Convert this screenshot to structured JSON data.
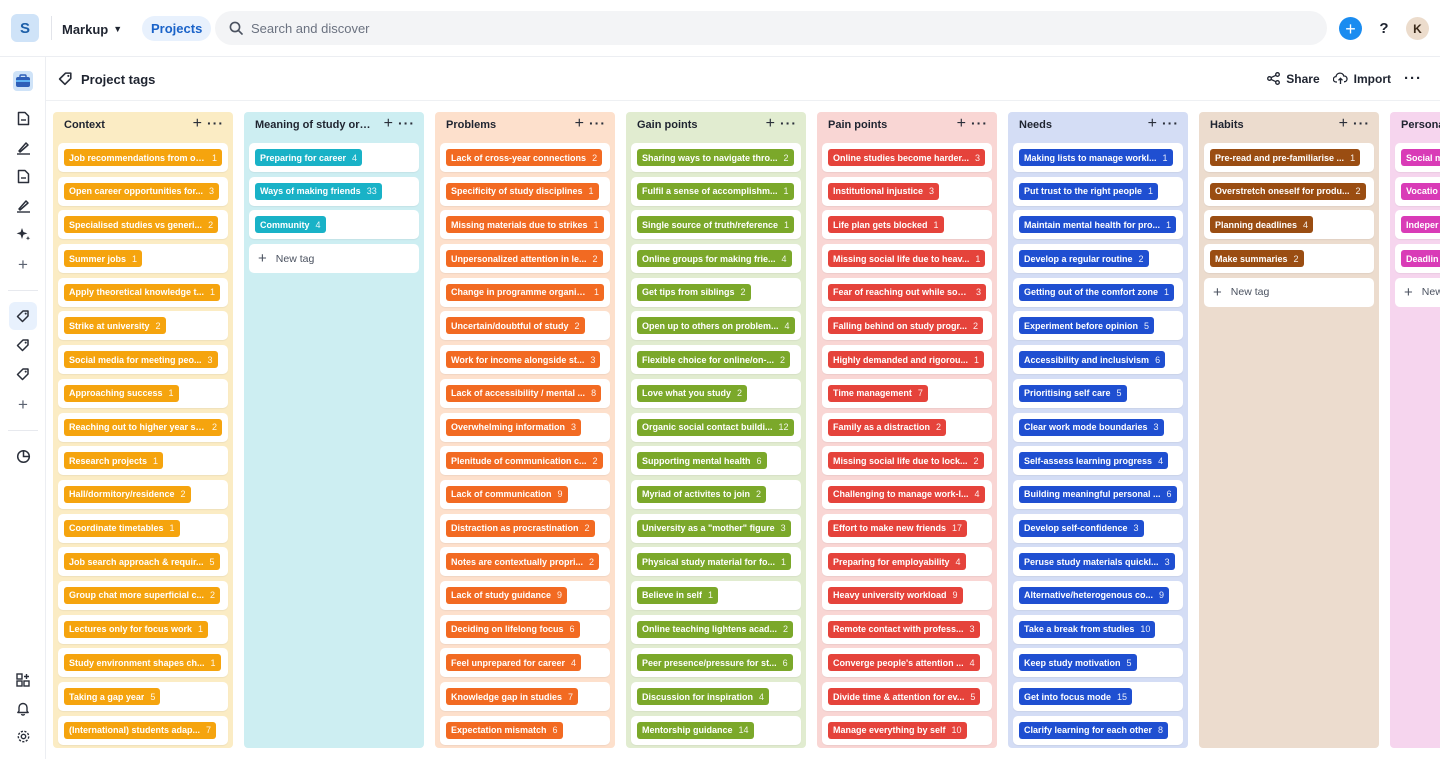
{
  "topbar": {
    "logo_letter": "S",
    "workspace": "Markup",
    "projects_label": "Projects",
    "search_placeholder": "Search and discover",
    "avatar_letter": "K",
    "help_label": "?"
  },
  "page": {
    "title": "Project tags",
    "share_label": "Share",
    "import_label": "Import"
  },
  "new_tag_label": "New tag",
  "columns": [
    {
      "title": "Context",
      "bg": "#fbecc4",
      "tag_color": "#f5a40e",
      "tags": [
        {
          "label": "Job recommendations from ot...",
          "count": "1"
        },
        {
          "label": "Open career opportunities for...",
          "count": "3"
        },
        {
          "label": "Specialised studies vs generi...",
          "count": "2"
        },
        {
          "label": "Summer jobs",
          "count": "1"
        },
        {
          "label": "Apply theoretical knowledge t...",
          "count": "1"
        },
        {
          "label": "Strike at university",
          "count": "2"
        },
        {
          "label": "Social media for meeting peo...",
          "count": "3"
        },
        {
          "label": "Approaching success",
          "count": "1"
        },
        {
          "label": "Reaching out to higher year st...",
          "count": "2"
        },
        {
          "label": "Research projects",
          "count": "1"
        },
        {
          "label": "Hall/dormitory/residence",
          "count": "2"
        },
        {
          "label": "Coordinate timetables",
          "count": "1"
        },
        {
          "label": "Job search approach & requir...",
          "count": "5"
        },
        {
          "label": "Group chat more superficial c...",
          "count": "2"
        },
        {
          "label": "Lectures only for focus work",
          "count": "1"
        },
        {
          "label": "Study environment shapes ch...",
          "count": "1"
        },
        {
          "label": "Taking a gap year",
          "count": "5"
        },
        {
          "label": "(International) students adap...",
          "count": "7"
        }
      ],
      "show_new_tag": false
    },
    {
      "title": "Meaning of study or ...",
      "bg": "#cdeef2",
      "tag_color": "#19b2c7",
      "tags": [
        {
          "label": "Preparing for career",
          "count": "4"
        },
        {
          "label": "Ways of making friends",
          "count": "33"
        },
        {
          "label": "Community",
          "count": "4"
        }
      ],
      "show_new_tag": true
    },
    {
      "title": "Problems",
      "bg": "#fde0cc",
      "tag_color": "#f26a22",
      "tags": [
        {
          "label": "Lack of cross-year connections",
          "count": "2"
        },
        {
          "label": "Specificity of study disciplines",
          "count": "1"
        },
        {
          "label": "Missing materials due to strikes",
          "count": "1"
        },
        {
          "label": "Unpersonalized attention in le...",
          "count": "2"
        },
        {
          "label": "Change in programme organis...",
          "count": "1"
        },
        {
          "label": "Uncertain/doubtful of study",
          "count": "2"
        },
        {
          "label": "Work for income alongside st...",
          "count": "3"
        },
        {
          "label": "Lack of accessibility / mental ...",
          "count": "8"
        },
        {
          "label": "Overwhelming information",
          "count": "3"
        },
        {
          "label": "Plenitude of communication c...",
          "count": "2"
        },
        {
          "label": "Lack of communication",
          "count": "9"
        },
        {
          "label": "Distraction as procrastination",
          "count": "2"
        },
        {
          "label": "Notes are contextually propri...",
          "count": "2"
        },
        {
          "label": "Lack of study guidance",
          "count": "9"
        },
        {
          "label": "Deciding on lifelong focus",
          "count": "6"
        },
        {
          "label": "Feel unprepared for career",
          "count": "4"
        },
        {
          "label": "Knowledge gap in studies",
          "count": "7"
        },
        {
          "label": "Expectation mismatch",
          "count": "6"
        }
      ],
      "show_new_tag": false
    },
    {
      "title": "Gain points",
      "bg": "#e1ecd0",
      "tag_color": "#7ba82a",
      "tags": [
        {
          "label": "Sharing ways to navigate thro...",
          "count": "2"
        },
        {
          "label": "Fulfil a sense of accomplishm...",
          "count": "1"
        },
        {
          "label": "Single source of truth/reference",
          "count": "1"
        },
        {
          "label": "Online groups for making frie...",
          "count": "4"
        },
        {
          "label": "Get tips from siblings",
          "count": "2"
        },
        {
          "label": "Open up to others on problem...",
          "count": "4"
        },
        {
          "label": "Flexible choice for online/on-...",
          "count": "2"
        },
        {
          "label": "Love what you study",
          "count": "2"
        },
        {
          "label": "Organic social contact buildi...",
          "count": "12"
        },
        {
          "label": "Supporting mental health",
          "count": "6"
        },
        {
          "label": "Myriad of activites to join",
          "count": "2"
        },
        {
          "label": "University as a \"mother\" figure",
          "count": "3"
        },
        {
          "label": "Physical study material for fo...",
          "count": "1"
        },
        {
          "label": "Believe in self",
          "count": "1"
        },
        {
          "label": "Online teaching lightens acad...",
          "count": "2"
        },
        {
          "label": "Peer presence/pressure for st...",
          "count": "6"
        },
        {
          "label": "Discussion for inspiration",
          "count": "4"
        },
        {
          "label": "Mentorship guidance",
          "count": "14"
        }
      ],
      "show_new_tag": false
    },
    {
      "title": "Pain points",
      "bg": "#f9d6d4",
      "tag_color": "#e5433b",
      "tags": [
        {
          "label": "Online studies become harder...",
          "count": "3"
        },
        {
          "label": "Institutional injustice",
          "count": "3"
        },
        {
          "label": "Life plan gets blocked",
          "count": "1"
        },
        {
          "label": "Missing social life due to heav...",
          "count": "1"
        },
        {
          "label": "Fear of reaching out while soc...",
          "count": "3"
        },
        {
          "label": "Falling behind on study progr...",
          "count": "2"
        },
        {
          "label": "Highly demanded and rigorou...",
          "count": "1"
        },
        {
          "label": "Time management",
          "count": "7"
        },
        {
          "label": "Family as a distraction",
          "count": "2"
        },
        {
          "label": "Missing social life due to lock...",
          "count": "2"
        },
        {
          "label": "Challenging to manage work-l...",
          "count": "4"
        },
        {
          "label": "Effort to make new friends",
          "count": "17"
        },
        {
          "label": "Preparing for employability",
          "count": "4"
        },
        {
          "label": "Heavy university workload",
          "count": "9"
        },
        {
          "label": "Remote contact with profess...",
          "count": "3"
        },
        {
          "label": "Converge people's attention ...",
          "count": "4"
        },
        {
          "label": "Divide time & attention for ev...",
          "count": "5"
        },
        {
          "label": "Manage everything by self",
          "count": "10"
        }
      ],
      "show_new_tag": false
    },
    {
      "title": "Needs",
      "bg": "#d4ddf5",
      "tag_color": "#1f4fd1",
      "tags": [
        {
          "label": "Making lists to manage workl...",
          "count": "1"
        },
        {
          "label": "Put trust to the right people",
          "count": "1"
        },
        {
          "label": "Maintain mental health for pro...",
          "count": "1"
        },
        {
          "label": "Develop a regular routine",
          "count": "2"
        },
        {
          "label": "Getting out of the comfort zone",
          "count": "1"
        },
        {
          "label": "Experiment before opinion",
          "count": "5"
        },
        {
          "label": "Accessibility and inclusivism",
          "count": "6"
        },
        {
          "label": "Prioritising self care",
          "count": "5"
        },
        {
          "label": "Clear work mode boundaries",
          "count": "3"
        },
        {
          "label": "Self-assess learning progress",
          "count": "4"
        },
        {
          "label": "Building meaningful personal ...",
          "count": "6"
        },
        {
          "label": "Develop self-confidence",
          "count": "3"
        },
        {
          "label": "Peruse study materials quickl...",
          "count": "3"
        },
        {
          "label": "Alternative/heterogenous co...",
          "count": "9"
        },
        {
          "label": "Take a break from studies",
          "count": "10"
        },
        {
          "label": "Keep study motivation",
          "count": "5"
        },
        {
          "label": "Get into focus mode",
          "count": "15"
        },
        {
          "label": "Clarify learning for each other",
          "count": "8"
        }
      ],
      "show_new_tag": false
    },
    {
      "title": "Habits",
      "bg": "#ecdcce",
      "tag_color": "#9a4d12",
      "tags": [
        {
          "label": "Pre-read and pre-familiarise ...",
          "count": "1"
        },
        {
          "label": "Overstretch oneself for produ...",
          "count": "2"
        },
        {
          "label": "Planning deadlines",
          "count": "4"
        },
        {
          "label": "Make summaries",
          "count": "2"
        }
      ],
      "show_new_tag": true
    },
    {
      "title": "Persona",
      "bg": "#f6d5ee",
      "tag_color": "#d93bb7",
      "tags": [
        {
          "label": "Social m",
          "count": ""
        },
        {
          "label": "Vocatio",
          "count": ""
        },
        {
          "label": "Indeper",
          "count": ""
        },
        {
          "label": "Deadlin",
          "count": ""
        }
      ],
      "show_new_tag": true
    }
  ]
}
